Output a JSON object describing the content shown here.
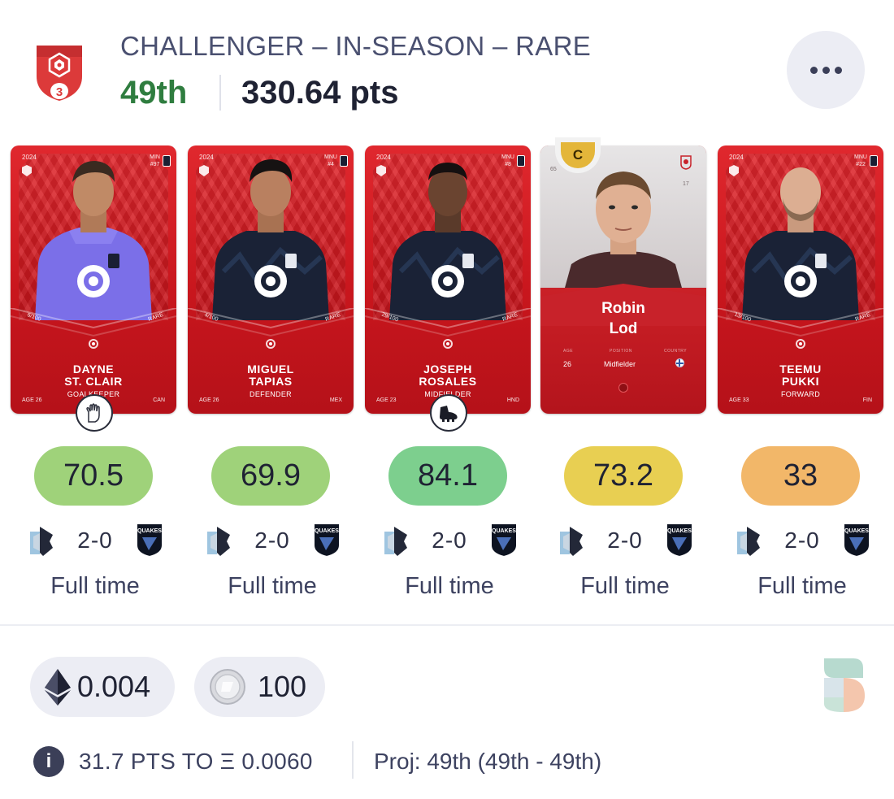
{
  "header": {
    "league_title": "CHALLENGER – IN-SEASON – RARE",
    "badge_level": "3",
    "rank": "49th",
    "points": "330.64 pts",
    "more_icon": "more-horizontal-icon"
  },
  "colors": {
    "card_red": "#d0202a",
    "score_green": "#9fd27a",
    "score_teal": "#7dcf8e",
    "score_yellow": "#e8cf52",
    "score_orange": "#f2b769",
    "rank_green": "#2f7d3f",
    "captain_gold": "#e4b63a"
  },
  "cards": [
    {
      "year": "2024",
      "corner_code": "MIN",
      "corner_number": "#97",
      "name": "DAYNE\nST. CLAIR",
      "position": "GOALKEEPER",
      "serial": "6/100",
      "rarity": "RARE",
      "age": "AGE 26",
      "country": "CAN",
      "kit": "goalkeeper-purple",
      "skill_icon": "goalkeeper-glove-icon",
      "score": "70.5",
      "score_color": "#9fd27a",
      "home_score": "2",
      "away_score": "0",
      "status": "Full time"
    },
    {
      "year": "2024",
      "corner_code": "MNU",
      "corner_number": "#4",
      "name": "MIGUEL\nTAPIAS",
      "position": "DEFENDER",
      "serial": "4/100",
      "rarity": "RARE",
      "age": "AGE 26",
      "country": "MEX",
      "kit": "navy",
      "skill_icon": "",
      "score": "69.9",
      "score_color": "#9fd27a",
      "home_score": "2",
      "away_score": "0",
      "status": "Full time"
    },
    {
      "year": "2024",
      "corner_code": "MNU",
      "corner_number": "#8",
      "name": "JOSEPH\nROSALES",
      "position": "MIDFIELDER",
      "serial": "29/100",
      "rarity": "RARE",
      "age": "AGE 23",
      "country": "HND",
      "kit": "navy",
      "skill_icon": "football-boot-icon",
      "score": "84.1",
      "score_color": "#7dcf8e",
      "home_score": "2",
      "away_score": "0",
      "status": "Full time"
    },
    {
      "special": true,
      "captain_label": "C",
      "rank_num": "65",
      "club_num": "17",
      "name": "Robin\nLod",
      "age_header": "AGE",
      "position_header": "POSITION",
      "country_header": "COUNTRY",
      "age": "26",
      "position": "Midfielder",
      "skill_icon": "",
      "score": "73.2",
      "score_color": "#e8cf52",
      "home_score": "2",
      "away_score": "0",
      "status": "Full time"
    },
    {
      "year": "2024",
      "corner_code": "MNU",
      "corner_number": "#22",
      "name": "TEEMU\nPUKKI",
      "position": "FORWARD",
      "serial": "13/100",
      "rarity": "RARE",
      "age": "AGE 33",
      "country": "FIN",
      "kit": "navy",
      "skill_icon": "",
      "score": "33",
      "score_color": "#f2b769",
      "home_score": "2",
      "away_score": "0",
      "status": "Full time"
    }
  ],
  "rewards": {
    "eth_icon": "ethereum-icon",
    "eth_value": "0.004",
    "coin_icon": "coin-icon",
    "coin_value": "100"
  },
  "info": {
    "icon": "info-icon",
    "text": "31.7 PTS TO Ξ 0.0060",
    "projection": "Proj: 49th (49th - 49th)"
  },
  "brand_icon": "sorare-logo-icon"
}
